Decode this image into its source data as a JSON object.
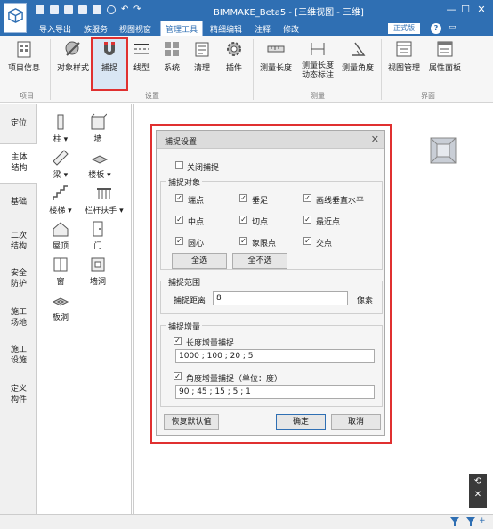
{
  "app": {
    "title": "BIMMAKE_Beta5 - [三维视图 - 三维]",
    "edition": "正式版",
    "help": "?"
  },
  "menu": [
    "导入导出",
    "族服务",
    "视图视窗",
    "管理工具",
    "精细编辑",
    "注释",
    "修改"
  ],
  "menu_active_index": 3,
  "ribbon": {
    "buttons": [
      {
        "label": "项目信息"
      },
      {
        "label": "对象样式"
      },
      {
        "label": "捕捉"
      },
      {
        "label": "线型"
      },
      {
        "label": "系统"
      },
      {
        "label": "清理"
      },
      {
        "label": "插件"
      },
      {
        "label": "测量长度"
      },
      {
        "label": "测量长度",
        "label2": "动态标注"
      },
      {
        "label": "测量角度"
      },
      {
        "label": "视图管理"
      },
      {
        "label": "属性面板"
      }
    ],
    "groups": [
      "项目",
      "设置",
      "测量",
      "界面"
    ]
  },
  "left_tabs": [
    {
      "line1": "定位",
      "line2": ""
    },
    {
      "line1": "主体",
      "line2": "结构"
    },
    {
      "line1": "基础",
      "line2": ""
    },
    {
      "line1": "二次",
      "line2": "结构"
    },
    {
      "line1": "安全",
      "line2": "防护"
    },
    {
      "line1": "施工",
      "line2": "场地"
    },
    {
      "line1": "施工",
      "line2": "设施"
    },
    {
      "line1": "定义",
      "line2": "构件"
    }
  ],
  "components": [
    {
      "label": "柱"
    },
    {
      "label": "墙"
    },
    {
      "label": "梁"
    },
    {
      "label": "楼板"
    },
    {
      "label": "楼梯"
    },
    {
      "label": "栏杆扶手"
    },
    {
      "label": "屋顶"
    },
    {
      "label": "门"
    },
    {
      "label": "窗"
    },
    {
      "label": "墙洞"
    },
    {
      "label": "板洞"
    }
  ],
  "dialog": {
    "title": "捕捉设置",
    "close_snap": {
      "label": "关闭捕捉",
      "checked": false
    },
    "snap_objects": {
      "legend": "捕捉对象",
      "items": [
        {
          "label": "端点",
          "checked": true
        },
        {
          "label": "垂足",
          "checked": true
        },
        {
          "label": "画线垂直水平",
          "checked": true
        },
        {
          "label": "中点",
          "checked": true
        },
        {
          "label": "切点",
          "checked": true
        },
        {
          "label": "最近点",
          "checked": true
        },
        {
          "label": "圆心",
          "checked": true
        },
        {
          "label": "象限点",
          "checked": true
        },
        {
          "label": "交点",
          "checked": true
        }
      ],
      "select_all": "全选",
      "select_none": "全不选"
    },
    "snap_range": {
      "legend": "捕捉范围",
      "label": "捕捉距离",
      "value": "8",
      "unit": "像素"
    },
    "snap_increment": {
      "legend": "捕捉增量",
      "length_label": "长度增量捕捉",
      "length_checked": true,
      "length_value": "1000 ; 100 ; 20 ; 5",
      "angle_label": "角度增量捕捉（单位：度）",
      "angle_checked": true,
      "angle_value": "90 ; 45 ; 15 ; 5 ; 1"
    },
    "restore": "恢复默认值",
    "ok": "确定",
    "cancel": "取消"
  },
  "nav": {
    "top": "⟲",
    "bottom": "✕"
  }
}
